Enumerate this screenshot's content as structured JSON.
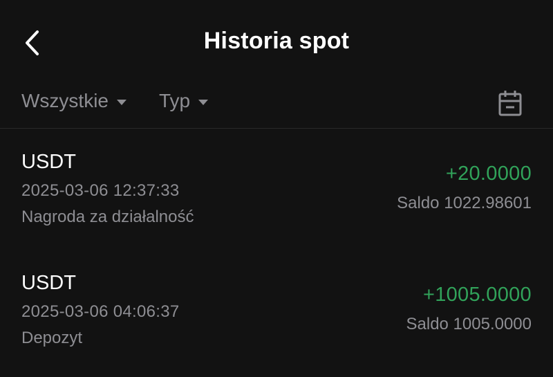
{
  "header": {
    "title": "Historia spot"
  },
  "filters": {
    "all_label": "Wszystkie",
    "type_label": "Typ"
  },
  "colors": {
    "background": "#121212",
    "positive_amount": "#31a35a",
    "secondary_text": "#8e8e93"
  },
  "transactions": [
    {
      "asset": "USDT",
      "datetime": "2025-03-06 12:37:33",
      "description": "Nagroda za działalność",
      "amount": "+20.0000",
      "balance": "Saldo 1022.98601"
    },
    {
      "asset": "USDT",
      "datetime": "2025-03-06 04:06:37",
      "description": "Depozyt",
      "amount": "+1005.0000",
      "balance": "Saldo 1005.0000"
    }
  ],
  "icons": {
    "back": "chevron-left-icon",
    "calendar": "calendar-icon"
  }
}
